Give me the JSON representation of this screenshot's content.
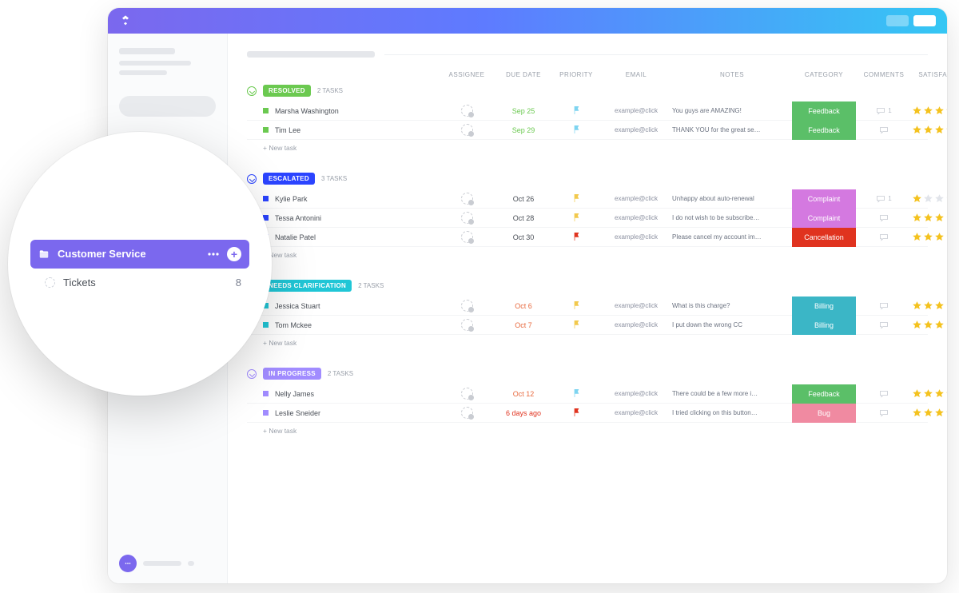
{
  "sidebar": {
    "folder_label": "Customer Service",
    "list_label": "Tickets",
    "list_count": "8"
  },
  "columns": {
    "name": "",
    "assignee": "ASSIGNEE",
    "due": "DUE DATE",
    "priority": "PRIORITY",
    "email": "EMAIL",
    "notes": "NOTES",
    "category": "CATEGORY",
    "comments": "COMMENTS",
    "satisfaction": "SATISFACTION LEVEL"
  },
  "new_task_label": "+ New task",
  "groups": [
    {
      "id": "resolved",
      "status": "RESOLVED",
      "color": "#6bc950",
      "count_label": "2 TASKS",
      "rows": [
        {
          "sq": "#6bc950",
          "name": "Marsha Washington",
          "due": "Sep 25",
          "due_class": "c-green",
          "flag": "#7ed4f0",
          "email": "example@click",
          "notes": "You guys are AMAZING!",
          "cat": "Feedback",
          "cat_bg": "#5bbf68",
          "comments": "1",
          "stars": 5
        },
        {
          "sq": "#6bc950",
          "name": "Tim Lee",
          "due": "Sep 29",
          "due_class": "c-green",
          "flag": "#7ed4f0",
          "email": "example@click",
          "notes": "THANK YOU for the great se…",
          "cat": "Feedback",
          "cat_bg": "#5bbf68",
          "comments": "",
          "stars": 5
        }
      ]
    },
    {
      "id": "escalated",
      "status": "ESCALATED",
      "color": "#2b44ff",
      "count_label": "3 TASKS",
      "rows": [
        {
          "sq": "#2b44ff",
          "name": "Kylie Park",
          "due": "Oct 26",
          "due_class": "",
          "flag": "#f2c94c",
          "email": "example@click",
          "notes": "Unhappy about auto-renewal",
          "cat": "Complaint",
          "cat_bg": "#d479e0",
          "comments": "1",
          "stars": 1
        },
        {
          "sq": "#2b44ff",
          "name": "Tessa Antonini",
          "due": "Oct 28",
          "due_class": "",
          "flag": "#f2c94c",
          "email": "example@click",
          "notes": "I do not wish to be subscribe…",
          "cat": "Complaint",
          "cat_bg": "#d479e0",
          "comments": "",
          "stars": 3
        },
        {
          "sq": "#2b44ff",
          "name": "Natalie Patel",
          "due": "Oct 30",
          "due_class": "",
          "flag": "#e0331f",
          "email": "example@click",
          "notes": "Please cancel my account im…",
          "cat": "Cancellation",
          "cat_bg": "#e0331f",
          "comments": "",
          "stars": 3
        }
      ]
    },
    {
      "id": "clarification",
      "status": "NEEDS CLARIFICATION",
      "color": "#20c6d6",
      "count_label": "2 TASKS",
      "rows": [
        {
          "sq": "#20c6d6",
          "name": "Jessica Stuart",
          "due": "Oct 6",
          "due_class": "c-orange",
          "flag": "#f2c94c",
          "email": "example@click",
          "notes": "What is this charge?",
          "cat": "Billing",
          "cat_bg": "#3bb6c6",
          "comments": "",
          "stars": 3
        },
        {
          "sq": "#20c6d6",
          "name": "Tom Mckee",
          "due": "Oct 7",
          "due_class": "c-orange",
          "flag": "#f2c94c",
          "email": "example@click",
          "notes": "I put down the wrong CC",
          "cat": "Billing",
          "cat_bg": "#3bb6c6",
          "comments": "",
          "stars": 3
        }
      ]
    },
    {
      "id": "inprogress",
      "status": "IN PROGRESS",
      "color": "#a18cff",
      "count_label": "2 TASKS",
      "rows": [
        {
          "sq": "#a18cff",
          "name": "Nelly James",
          "due": "Oct 12",
          "due_class": "c-orange",
          "flag": "#7ed4f0",
          "email": "example@click",
          "notes": "There could be a few more i…",
          "cat": "Feedback",
          "cat_bg": "#5bbf68",
          "comments": "",
          "stars": 5
        },
        {
          "sq": "#a18cff",
          "name": "Leslie Sneider",
          "due": "6 days ago",
          "due_class": "c-red",
          "flag": "#e0331f",
          "email": "example@click",
          "notes": "I tried clicking on this button…",
          "cat": "Bug",
          "cat_bg": "#f08aa1",
          "comments": "",
          "stars": 4
        }
      ]
    }
  ]
}
